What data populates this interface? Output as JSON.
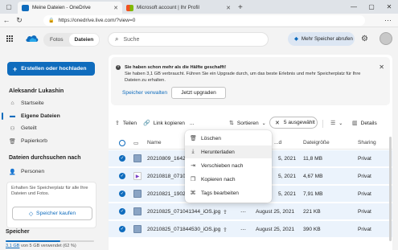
{
  "browser": {
    "tabs": [
      {
        "title": "Meine Dateien - OneDrive",
        "active": true
      },
      {
        "title": "Microsoft account | Ihr Profil",
        "active": false
      }
    ],
    "url": "https://onedrive.live.com/?view=0"
  },
  "header": {
    "seg_photos": "Fotos",
    "seg_files": "Dateien",
    "search_placeholder": "Suche",
    "premium_label": "Mehr Speicher abrufen"
  },
  "sidebar": {
    "create_label": "Erstellen oder hochladen",
    "user_name": "Aleksandr Lukashin",
    "items": [
      {
        "label": "Startseite",
        "icon": "home-icon"
      },
      {
        "label": "Eigene Dateien",
        "icon": "folder-icon",
        "active": true
      },
      {
        "label": "Geteilt",
        "icon": "shared-icon"
      },
      {
        "label": "Papierkorb",
        "icon": "trash-icon"
      }
    ],
    "browse_header": "Dateien durchsuchen nach",
    "browse_items": [
      {
        "label": "Personen",
        "icon": "person-icon"
      }
    ],
    "promo_text": "Erhalten Sie Speicherplatz für alle Ihre Dateien und Fotos.",
    "promo_button": "Speicher kaufen",
    "storage_header": "Speicher",
    "storage_used_value": "3,1 GB",
    "storage_used_suffix": "von 5 GB verwendet (62 %)",
    "storage_fraction": 0.62
  },
  "banner": {
    "title": "Sie haben schon mehr als die Hälfte geschafft!",
    "body": "Sie haben 3,1 GB verbraucht. Führen Sie ein Upgrade durch, um das beste Erlebnis und mehr Speicherplatz für Ihre Dateien zu erhalten.",
    "link": "Speicher verwalten",
    "button": "Jetzt upgraden"
  },
  "command_bar": {
    "share": "Teilen",
    "copy_link": "Link kopieren",
    "more": "...",
    "sort": "Sortieren",
    "selected": "5 ausgewählt",
    "details": "Details"
  },
  "table": {
    "columns": {
      "name": "Name",
      "modified": "...d",
      "size": "Dateigröße",
      "sharing": "Sharing"
    },
    "rows": [
      {
        "name": "20210809_164219",
        "type": "image",
        "modified": "5, 2021",
        "size": "11,8 MB",
        "sharing": "Privat"
      },
      {
        "name": "20210818_071016",
        "type": "video",
        "modified": "5, 2021",
        "size": "4,67 MB",
        "sharing": "Privat"
      },
      {
        "name": "20210821_190207",
        "type": "image",
        "modified": "5, 2021",
        "size": "7,91 MB",
        "sharing": "Privat"
      },
      {
        "name": "20210825_071041344_iOS.jpg",
        "type": "image",
        "modified": "August 25, 2021",
        "size": "221 KB",
        "sharing": "Privat"
      },
      {
        "name": "20210825_071844530_iOS.jpg",
        "type": "image",
        "modified": "August 25, 2021",
        "size": "390 KB",
        "sharing": "Privat"
      }
    ]
  },
  "menu": {
    "items": [
      {
        "label": "Löschen",
        "icon": "trash-icon"
      },
      {
        "label": "Herunterladen",
        "icon": "download-icon",
        "hover": true
      },
      {
        "label": "Verschieben nach",
        "icon": "move-icon"
      },
      {
        "label": "Kopieren nach",
        "icon": "copy-icon"
      },
      {
        "label": "Tags bearbeiten",
        "icon": "tag-icon"
      }
    ]
  },
  "colors": {
    "accent": "#0f6cbd",
    "selected_row": "#ebf3fc"
  }
}
